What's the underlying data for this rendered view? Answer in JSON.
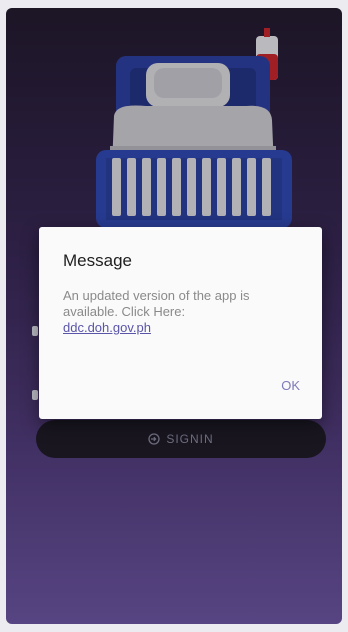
{
  "dialog": {
    "title": "Message",
    "message": "An updated version of the app is available. Click Here:",
    "link_text": "ddc.doh.gov.ph",
    "ok_label": "OK"
  },
  "signin": {
    "label": "SIGNIN",
    "icon": "signin-icon"
  },
  "illustration": {
    "icon": "hospital-bed-icon",
    "accent_colors": [
      "#2d3f9e",
      "#c2272d",
      "#d7d7dc"
    ]
  }
}
